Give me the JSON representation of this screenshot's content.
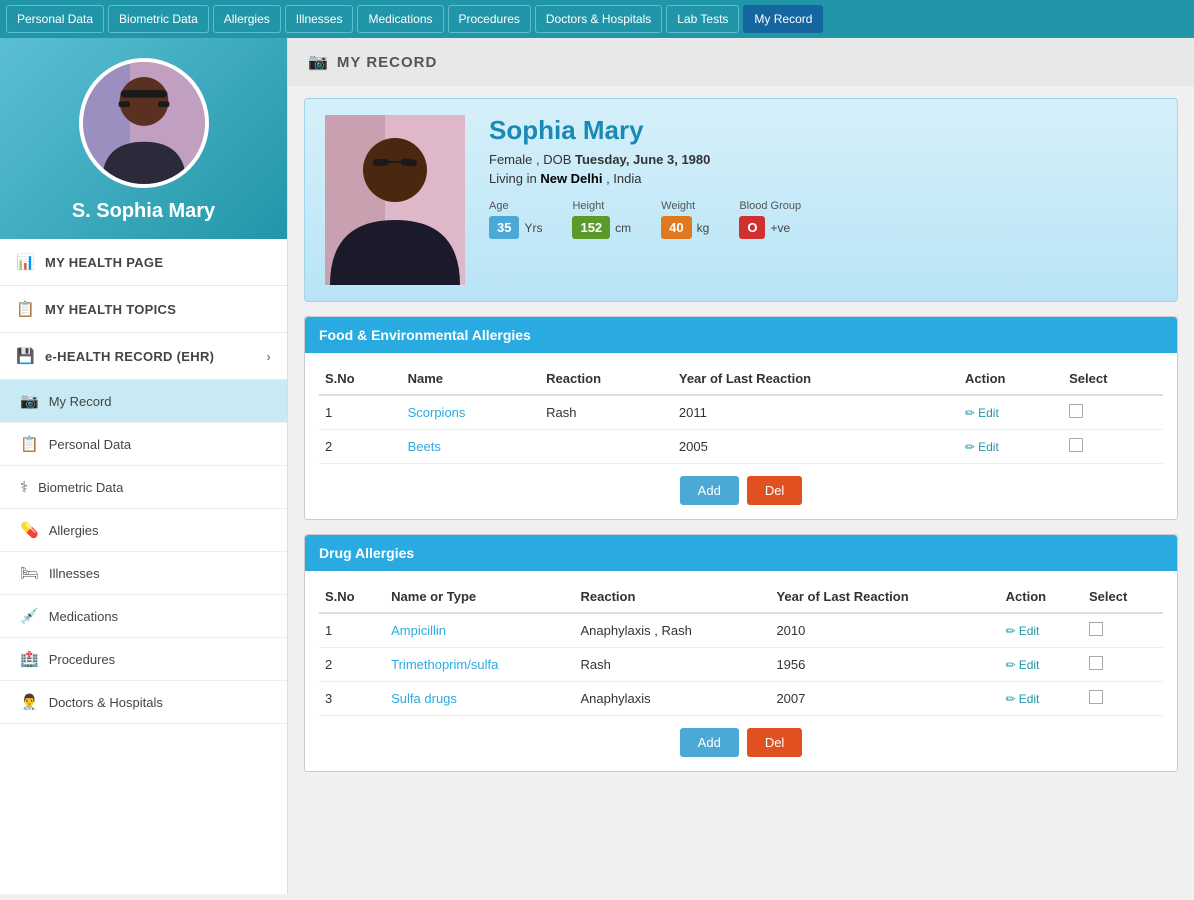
{
  "topNav": {
    "items": [
      {
        "label": "Personal Data",
        "active": false
      },
      {
        "label": "Biometric Data",
        "active": false
      },
      {
        "label": "Allergies",
        "active": false
      },
      {
        "label": "Illnesses",
        "active": false
      },
      {
        "label": "Medications",
        "active": false
      },
      {
        "label": "Procedures",
        "active": false
      },
      {
        "label": "Doctors & Hospitals",
        "active": false
      },
      {
        "label": "Lab Tests",
        "active": false
      },
      {
        "label": "My Record",
        "active": true
      }
    ]
  },
  "sidebar": {
    "name": "S. Sophia Mary",
    "sections": [
      {
        "label": "MY HEALTH PAGE",
        "icon": "📊",
        "type": "section"
      },
      {
        "label": "MY HEALTH TOPICS",
        "icon": "📋",
        "type": "section"
      },
      {
        "label": "e-HEALTH RECORD (EHR)",
        "icon": "💾",
        "type": "section",
        "hasChevron": true
      }
    ],
    "items": [
      {
        "label": "My Record",
        "icon": "📷",
        "active": true
      },
      {
        "label": "Personal Data",
        "icon": "📋",
        "active": false
      },
      {
        "label": "Biometric Data",
        "icon": "⚕",
        "active": false
      },
      {
        "label": "Allergies",
        "icon": "💊",
        "active": false
      },
      {
        "label": "Illnesses",
        "icon": "🛏",
        "active": false
      },
      {
        "label": "Medications",
        "icon": "💉",
        "active": false
      },
      {
        "label": "Procedures",
        "icon": "🏥",
        "active": false
      },
      {
        "label": "Doctors & Hospitals",
        "icon": "👨‍⚕️",
        "active": false
      }
    ]
  },
  "pageHeader": {
    "icon": "📷",
    "title": "MY RECORD"
  },
  "profile": {
    "name": "Sophia  Mary",
    "gender": "Female",
    "dobLabel": "DOB",
    "dob": "Tuesday, June 3, 1980",
    "locationLabel": "Living in",
    "location": "New Delhi",
    "country": "India",
    "stats": {
      "age": {
        "label": "Age",
        "value": "35",
        "unit": "Yrs",
        "badgeClass": "badge-blue"
      },
      "height": {
        "label": "Height",
        "value": "152",
        "unit": "cm",
        "badgeClass": "badge-green"
      },
      "weight": {
        "label": "Weight",
        "value": "40",
        "unit": "kg",
        "badgeClass": "badge-orange"
      },
      "bloodGroup": {
        "label": "Blood Group",
        "value": "O",
        "unit": "+ve",
        "badgeClass": "badge-red"
      }
    }
  },
  "foodAllergies": {
    "title": "Food & Environmental Allergies",
    "columns": [
      "S.No",
      "Name",
      "Reaction",
      "Year of Last Reaction",
      "Action",
      "Select"
    ],
    "rows": [
      {
        "sno": "1",
        "name": "Scorpions",
        "reaction": "Rash",
        "year": "2011"
      },
      {
        "sno": "2",
        "name": "Beets",
        "reaction": "",
        "year": "2005"
      }
    ],
    "addLabel": "Add",
    "delLabel": "Del"
  },
  "drugAllergies": {
    "title": "Drug Allergies",
    "columns": [
      "S.No",
      "Name or Type",
      "Reaction",
      "Year of Last Reaction",
      "Action",
      "Select"
    ],
    "rows": [
      {
        "sno": "1",
        "name": "Ampicillin",
        "reaction": "Anaphylaxis , Rash",
        "year": "2010"
      },
      {
        "sno": "2",
        "name": "Trimethoprim/sulfa",
        "reaction": "Rash",
        "year": "1956"
      },
      {
        "sno": "3",
        "name": "Sulfa drugs",
        "reaction": "Anaphylaxis",
        "year": "2007"
      }
    ],
    "addLabel": "Add",
    "delLabel": "Del"
  }
}
